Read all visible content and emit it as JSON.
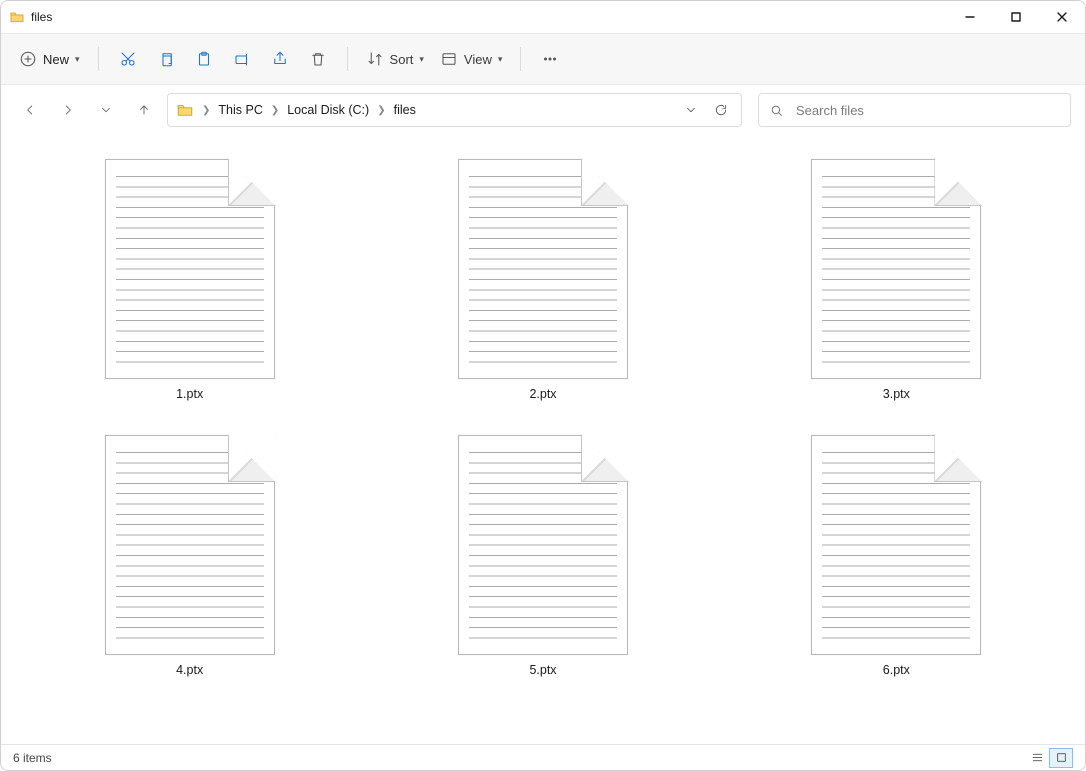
{
  "window": {
    "title": "files"
  },
  "toolbar": {
    "new_label": "New",
    "sort_label": "Sort",
    "view_label": "View"
  },
  "breadcrumb": {
    "items": [
      "This PC",
      "Local Disk (C:)",
      "files"
    ]
  },
  "search": {
    "placeholder": "Search files"
  },
  "files": [
    {
      "name": "1.ptx"
    },
    {
      "name": "2.ptx"
    },
    {
      "name": "3.ptx"
    },
    {
      "name": "4.ptx"
    },
    {
      "name": "5.ptx"
    },
    {
      "name": "6.ptx"
    }
  ],
  "status": {
    "item_count_text": "6 items"
  }
}
